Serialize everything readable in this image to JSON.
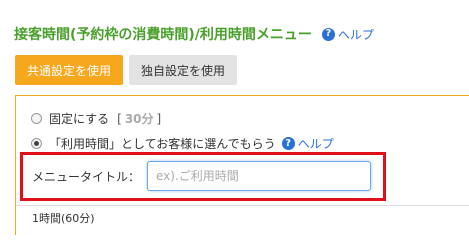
{
  "header": {
    "title": "接客時間(予約枠の消費時間)/利用時間メニュー",
    "help_label": "ヘルプ",
    "help_icon": "question-circle-icon"
  },
  "tabs": [
    {
      "label": "共通設定を使用",
      "active": true
    },
    {
      "label": "独自設定を使用",
      "active": false
    }
  ],
  "options": {
    "fixed": {
      "label": "固定にする",
      "bracket_open": "[",
      "minutes": "30分",
      "bracket_close": "]",
      "checked": false
    },
    "usage": {
      "label": "「利用時間」としてお客様に選んでもらう",
      "help_label": "ヘルプ",
      "checked": true
    }
  },
  "menu_title": {
    "label": "メニュータイトル：",
    "value": "",
    "placeholder": "ex).ご利用時間"
  },
  "durations": [
    {
      "label": "1時間(60分)"
    }
  ],
  "colors": {
    "title_green": "#4aa02c",
    "accent_orange": "#f6a71c",
    "link_blue": "#2a6fd6",
    "highlight_red": "#e0101a"
  }
}
